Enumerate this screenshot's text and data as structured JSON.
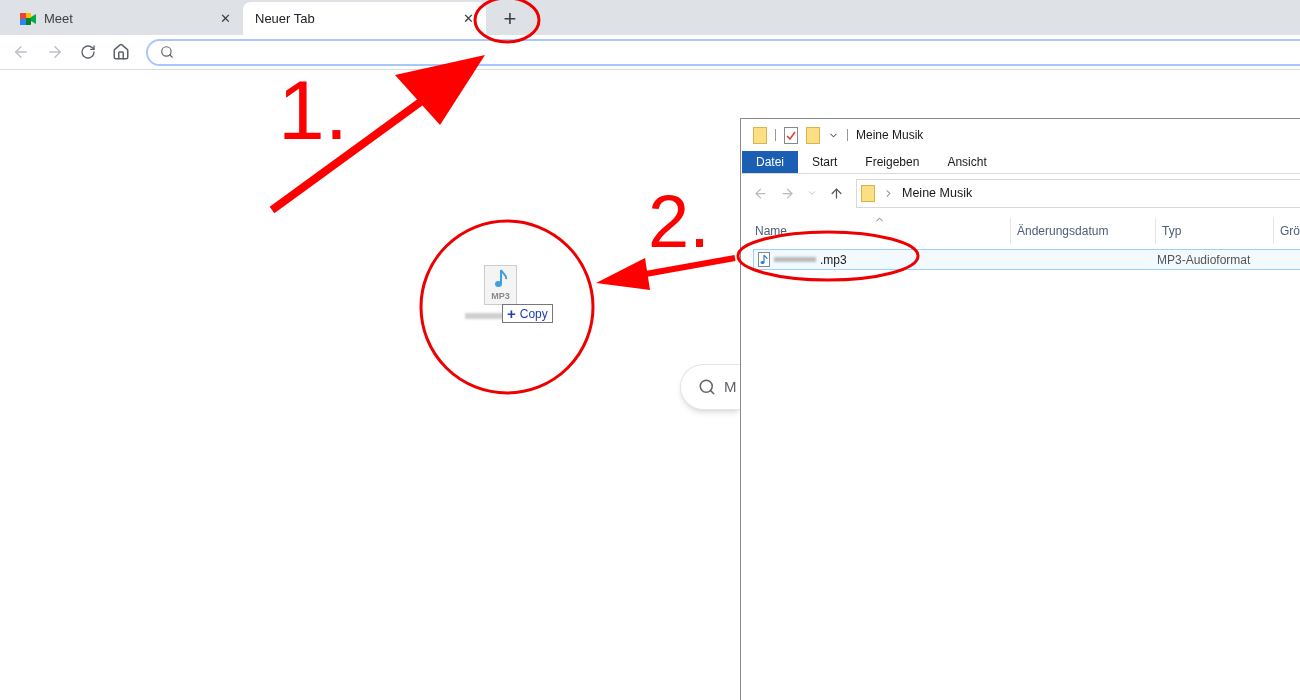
{
  "browser": {
    "tabs": [
      {
        "title": "Meet",
        "selected": false,
        "close": "✕"
      },
      {
        "title": "Neuer Tab",
        "selected": true,
        "close": "✕"
      }
    ],
    "new_tab": "+",
    "search": {
      "placeholder": "M"
    }
  },
  "drag": {
    "file_label": "MP3",
    "tooltip": {
      "sign": "+",
      "label": "Copy"
    }
  },
  "explorer": {
    "title": "Meine Musik",
    "ribbon_tabs": [
      {
        "label": "Datei",
        "selected": true
      },
      {
        "label": "Start",
        "selected": false
      },
      {
        "label": "Freigeben",
        "selected": false
      },
      {
        "label": "Ansicht",
        "selected": false
      }
    ],
    "path": "Meine Musik",
    "columns": [
      "Name",
      "Änderungsdatum",
      "Typ",
      "Grö"
    ],
    "files": [
      {
        "name": ".mp3",
        "type": "MP3-Audioformat",
        "selected": true
      }
    ]
  },
  "annotations": [
    {
      "label": "1."
    },
    {
      "label": "2."
    }
  ]
}
